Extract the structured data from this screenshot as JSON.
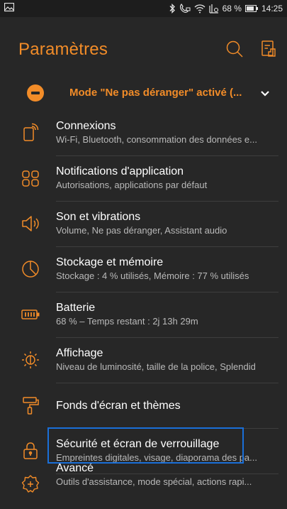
{
  "status_bar": {
    "battery_percent": "68 %",
    "time": "14:25"
  },
  "header": {
    "title": "Paramètres"
  },
  "dnd": {
    "label": "Mode \"Ne pas déranger\" activé (..."
  },
  "colors": {
    "accent": "#f28c28",
    "background": "#272727",
    "focus": "#1a6fd8"
  },
  "items": [
    {
      "icon": "connections-icon",
      "title": "Connexions",
      "subtitle": "Wi-Fi, Bluetooth, consommation des données e..."
    },
    {
      "icon": "app-notifications-icon",
      "title": "Notifications d'application",
      "subtitle": "Autorisations, applications par défaut"
    },
    {
      "icon": "sound-icon",
      "title": "Son et vibrations",
      "subtitle": "Volume, Ne pas déranger, Assistant audio"
    },
    {
      "icon": "storage-icon",
      "title": "Stockage et mémoire",
      "subtitle": "Stockage : 4 % utilisés, Mémoire : 77 % utilisés"
    },
    {
      "icon": "battery-icon",
      "title": "Batterie",
      "subtitle": "68 % – Temps restant : 2j 13h 29m"
    },
    {
      "icon": "display-icon",
      "title": "Affichage",
      "subtitle": "Niveau de luminosité, taille de la police, Splendid"
    },
    {
      "icon": "wallpaper-themes-icon",
      "title": "Fonds d'écran et thèmes",
      "subtitle": ""
    },
    {
      "icon": "lock-icon",
      "title": "Sécurité et écran de verrouillage",
      "subtitle": "Empreintes digitales, visage, diaporama des pa..."
    },
    {
      "icon": "advanced-icon",
      "title": "Avancé",
      "subtitle": "Outils d'assistance, mode spécial, actions rapi..."
    }
  ]
}
